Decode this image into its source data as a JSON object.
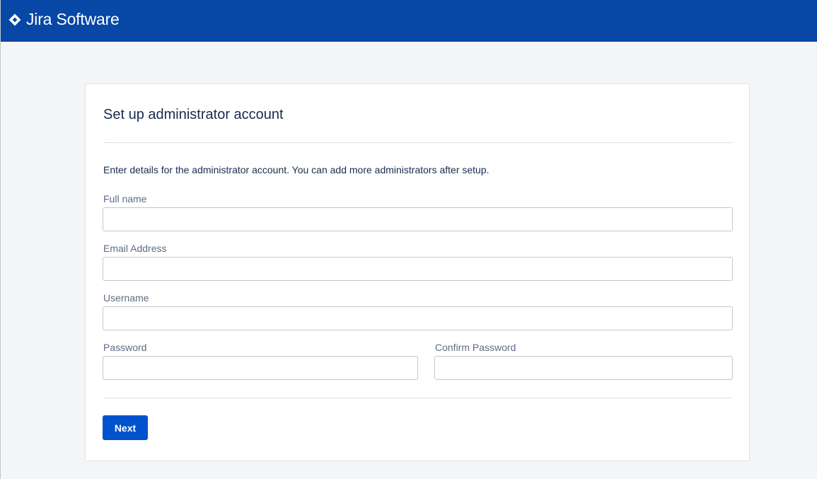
{
  "header": {
    "app_name": "Jira Software",
    "logo_icon": "jira-diamond-icon",
    "background_color": "#0747a6"
  },
  "panel": {
    "title": "Set up administrator account",
    "intro": "Enter details for the administrator account. You can add more administrators after setup."
  },
  "form": {
    "full_name": {
      "label": "Full name",
      "value": "",
      "placeholder": ""
    },
    "email": {
      "label": "Email Address",
      "value": "",
      "placeholder": ""
    },
    "username": {
      "label": "Username",
      "value": "",
      "placeholder": ""
    },
    "password": {
      "label": "Password",
      "value": "",
      "placeholder": ""
    },
    "confirm_password": {
      "label": "Confirm Password",
      "value": "",
      "placeholder": ""
    }
  },
  "actions": {
    "next_label": "Next",
    "primary_color": "#0052cc"
  }
}
